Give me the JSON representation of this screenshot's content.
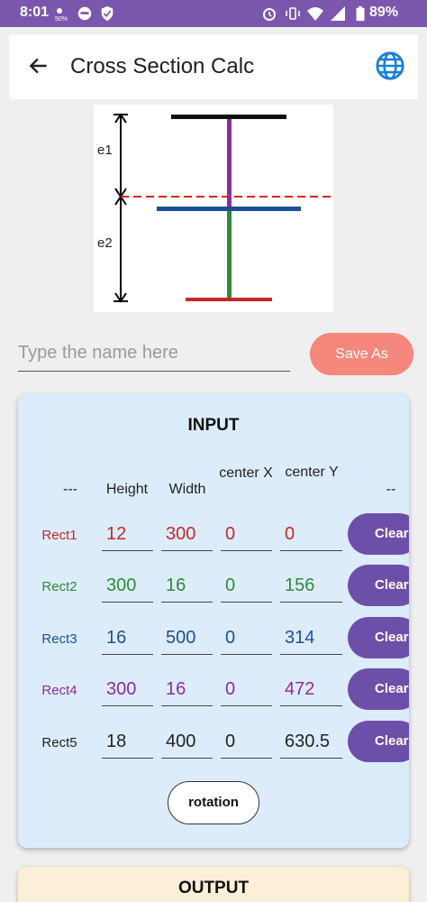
{
  "status_bar": {
    "time": "8:01",
    "battery": "89%",
    "bg_color": "#7a57ad"
  },
  "app_bar": {
    "title": "Cross Section Calc",
    "back_icon": "arrow-back-icon",
    "globe_icon": "globe-icon",
    "accent": "#1a7fd9"
  },
  "diagram": {
    "label_top": "e1",
    "label_bottom": "e2"
  },
  "name_field": {
    "placeholder": "Type the name here",
    "value": ""
  },
  "save_button": {
    "label": "Save As",
    "color": "#f5877c"
  },
  "input_card": {
    "title": "INPUT",
    "headers": {
      "first": "---",
      "height": "Height",
      "width": "Width",
      "center_x": "center X",
      "center_y": "center Y",
      "last": "--"
    },
    "rows": [
      {
        "label": "Rect1",
        "height": "12",
        "width": "300",
        "center_x": "0",
        "center_y": "0",
        "clear": "Clear",
        "color": "#c62828"
      },
      {
        "label": "Rect2",
        "height": "300",
        "width": "16",
        "center_x": "0",
        "center_y": "156",
        "clear": "Clear",
        "color": "#2e8b3a"
      },
      {
        "label": "Rect3",
        "height": "16",
        "width": "500",
        "center_x": "0",
        "center_y": "314",
        "clear": "Clear",
        "color": "#1e4f95"
      },
      {
        "label": "Rect4",
        "height": "300",
        "width": "16",
        "center_x": "0",
        "center_y": "472",
        "clear": "Clear",
        "color": "#8e2ba0"
      },
      {
        "label": "Rect5",
        "height": "18",
        "width": "400",
        "center_x": "0",
        "center_y": "630.5",
        "clear": "Clear",
        "color": "#222222"
      }
    ],
    "rotation_label": "rotation"
  },
  "output_card": {
    "title": "OUTPUT"
  }
}
